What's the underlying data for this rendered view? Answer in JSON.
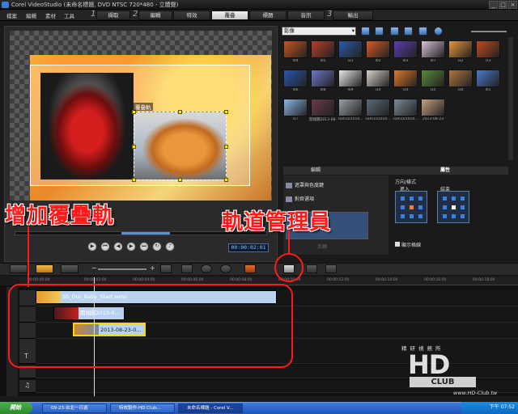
{
  "window": {
    "title": "Corel VideoStudio (未命名標題, DVD NTSC 720*480 - 立體聲)",
    "buttons": [
      "_",
      "□",
      "×"
    ]
  },
  "menu": [
    "檔案",
    "編輯",
    "素材",
    "工具"
  ],
  "steps": [
    {
      "num": "1",
      "label": "擷取"
    },
    {
      "num": "2",
      "label": "編輯"
    },
    {
      "num": "",
      "label": "特效"
    },
    {
      "num": "",
      "label": "覆疊"
    },
    {
      "num": "",
      "label": "標題"
    },
    {
      "num": "",
      "label": "音訊"
    },
    {
      "num": "3",
      "label": "輸出"
    }
  ],
  "active_step": "覆疊",
  "preview": {
    "overlay_label": "覆疊軌",
    "timecode": "00:00:02:01"
  },
  "playback_icons": [
    "play-icon",
    "home-icon",
    "prev-frame-icon",
    "next-frame-icon",
    "end-icon",
    "repeat-icon",
    "volume-icon"
  ],
  "library": {
    "category": "影像",
    "thumbnails": [
      {
        "label": "I04",
        "color": "#c8551e"
      },
      {
        "label": "I05",
        "color": "#b8402a"
      },
      {
        "label": "I11",
        "color": "#2b58a8"
      },
      {
        "label": "I02",
        "color": "#d85a22"
      },
      {
        "label": "I03",
        "color": "#5a3cae"
      },
      {
        "label": "I07",
        "color": "#d9c0d8"
      },
      {
        "label": "I12",
        "color": "#e8963a"
      },
      {
        "label": "I13",
        "color": "#c04a1e"
      },
      {
        "label": "I06",
        "color": "#2a56b0"
      },
      {
        "label": "I08",
        "color": "#6a78c8"
      },
      {
        "label": "I09",
        "color": "#e8e8e8"
      },
      {
        "label": "I10",
        "color": "#d8d0c8"
      },
      {
        "label": "I14",
        "color": "#e07a2a"
      },
      {
        "label": "I15",
        "color": "#5a8a3a"
      },
      {
        "label": "I16",
        "color": "#b07840"
      },
      {
        "label": "I01",
        "color": "#4a7ac8"
      },
      {
        "label": "I17",
        "color": "#8ab8e8"
      },
      {
        "label": "開端圖2013-08-",
        "color": "#6a3a4a"
      },
      {
        "label": "sam101010...",
        "color": "#9aa0a8"
      },
      {
        "label": "sam101010...",
        "color": "#5a6a7a"
      },
      {
        "label": "sam101010...",
        "color": "#7a8a9a"
      },
      {
        "label": "2013-08-23",
        "color": "#c8a080"
      }
    ]
  },
  "options": {
    "tabs": [
      "編輯",
      "屬性"
    ],
    "rows": [
      "遮罩與色度鍵",
      "對齊選項"
    ],
    "extra": "進入",
    "extra2": "結束",
    "direction_title": "方向/樣式",
    "checkbox": "顯示格線",
    "reverse_label": "反轉"
  },
  "toolbar": {
    "tools": [
      "storyboard-view",
      "timeline-view",
      "audio-view",
      "zoom-out",
      "zoom-in",
      "fit",
      "undo",
      "redo",
      "record",
      "track-manager",
      "chapter",
      "auto-music"
    ]
  },
  "ruler": [
    "00:00:00:00",
    "00:00:02:00",
    "00:00:04:00",
    "00:00:06:00",
    "00:00:08:00",
    "00:00:10:00",
    "00:00:12:00",
    "00:00:14:00",
    "00:00:16:00",
    "00:00:18:00"
  ],
  "tracks": [
    {
      "icon": "video-track-icon",
      "clip": "SS_Our_Baby_Start.wmv"
    },
    {
      "icon": "overlay-track-1-icon",
      "clip": "開端圖2013-0..."
    },
    {
      "icon": "overlay-track-2-icon",
      "clip": "2013-08-23-0..."
    },
    {
      "icon": "overlay-track-3-icon",
      "clip": ""
    },
    {
      "icon": "title-track-icon",
      "clip": ""
    },
    {
      "icon": "voice-track-icon",
      "clip": ""
    },
    {
      "icon": "music-track-icon",
      "clip": ""
    }
  ],
  "annotations": {
    "left": "增加覆疊軌",
    "right": "軌道管理員"
  },
  "watermark": {
    "cn": "精研視務所",
    "hd": "HD",
    "club": "CLUB",
    "url": "www.HD-Club.tw"
  },
  "taskbar": {
    "start": "開始",
    "items": [
      "09-23-台北一日遊",
      "特效製作-HD.Club...",
      "未命名標題 - Corel V..."
    ],
    "clock": "下午 07:52"
  }
}
